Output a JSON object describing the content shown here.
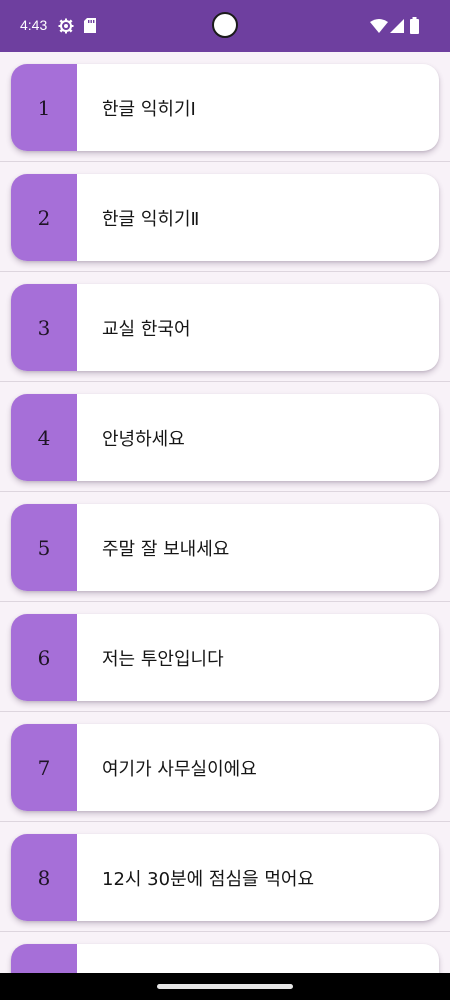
{
  "status_bar": {
    "time": "4:43",
    "background_color": "#6e3f9f",
    "icons": [
      "settings-gear-icon",
      "sd-card-icon",
      "wifi-icon",
      "cell-signal-icon",
      "battery-icon"
    ]
  },
  "lessons": {
    "accent_color": "#a66fd8",
    "items": [
      {
        "number": "1",
        "title": "한글 익히기Ⅰ"
      },
      {
        "number": "2",
        "title": "한글 익히기Ⅱ"
      },
      {
        "number": "3",
        "title": "교실 한국어"
      },
      {
        "number": "4",
        "title": "안녕하세요"
      },
      {
        "number": "5",
        "title": "주말 잘 보내세요"
      },
      {
        "number": "6",
        "title": "저는 투안입니다"
      },
      {
        "number": "7",
        "title": "여기가 사무실이에요"
      },
      {
        "number": "8",
        "title": "12시 30분에 점심을 먹어요"
      },
      {
        "number": "",
        "title": ""
      }
    ]
  }
}
